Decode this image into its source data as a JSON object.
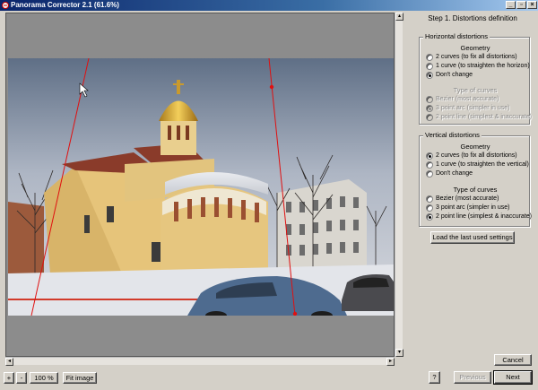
{
  "window": {
    "title": "Panorama Corrector 2.1 (61.6%)",
    "controls": {
      "minimize": "_",
      "maximize": "▫",
      "close": "×"
    }
  },
  "toolbar": {
    "zoom_in": "+",
    "zoom_out": "-",
    "zoom_level": "100 %",
    "fit_image": "Fit image",
    "help": "?",
    "previous": "Previous",
    "next": "Next",
    "cancel": "Cancel"
  },
  "panel": {
    "step_title": "Step 1. Distortions definition",
    "horizontal": {
      "title": "Horizontal distortions",
      "geometry_label": "Geometry",
      "geometry_options": [
        {
          "label": "2 curves  (to fix all distortions)",
          "checked": false,
          "disabled": false
        },
        {
          "label": "1 curve  (to straighten the horizon)",
          "checked": false,
          "disabled": false
        },
        {
          "label": "Don't change",
          "checked": true,
          "disabled": false
        }
      ],
      "curves_label": "Type of curves",
      "curve_options": [
        {
          "label": "Bezier  (most accurate)",
          "checked": false,
          "disabled": true
        },
        {
          "label": "3 point arc  (simpler in use)",
          "checked": true,
          "disabled": true
        },
        {
          "label": "2 point line  (simplest & inaccurate)",
          "checked": false,
          "disabled": true
        }
      ]
    },
    "vertical": {
      "title": "Vertical distortions",
      "geometry_label": "Geometry",
      "geometry_options": [
        {
          "label": "2 curves  (to fix all distortions)",
          "checked": true,
          "disabled": false
        },
        {
          "label": "1 curve  (to straighten the vertical)",
          "checked": false,
          "disabled": false
        },
        {
          "label": "Don't change",
          "checked": false,
          "disabled": false
        }
      ],
      "curves_label": "Type of curves",
      "curve_options": [
        {
          "label": "Bezier  (most accurate)",
          "checked": false,
          "disabled": false
        },
        {
          "label": "3 point arc  (simpler in use)",
          "checked": false,
          "disabled": false
        },
        {
          "label": "2 point line  (simplest & inaccurate)",
          "checked": true,
          "disabled": false
        }
      ]
    },
    "load_last": "Load the last used settings"
  },
  "colors": {
    "guide_line": "#e01010",
    "sky": "#c9ccd3",
    "church_wall": "#e2c47e",
    "dome": "#d9a92a"
  }
}
